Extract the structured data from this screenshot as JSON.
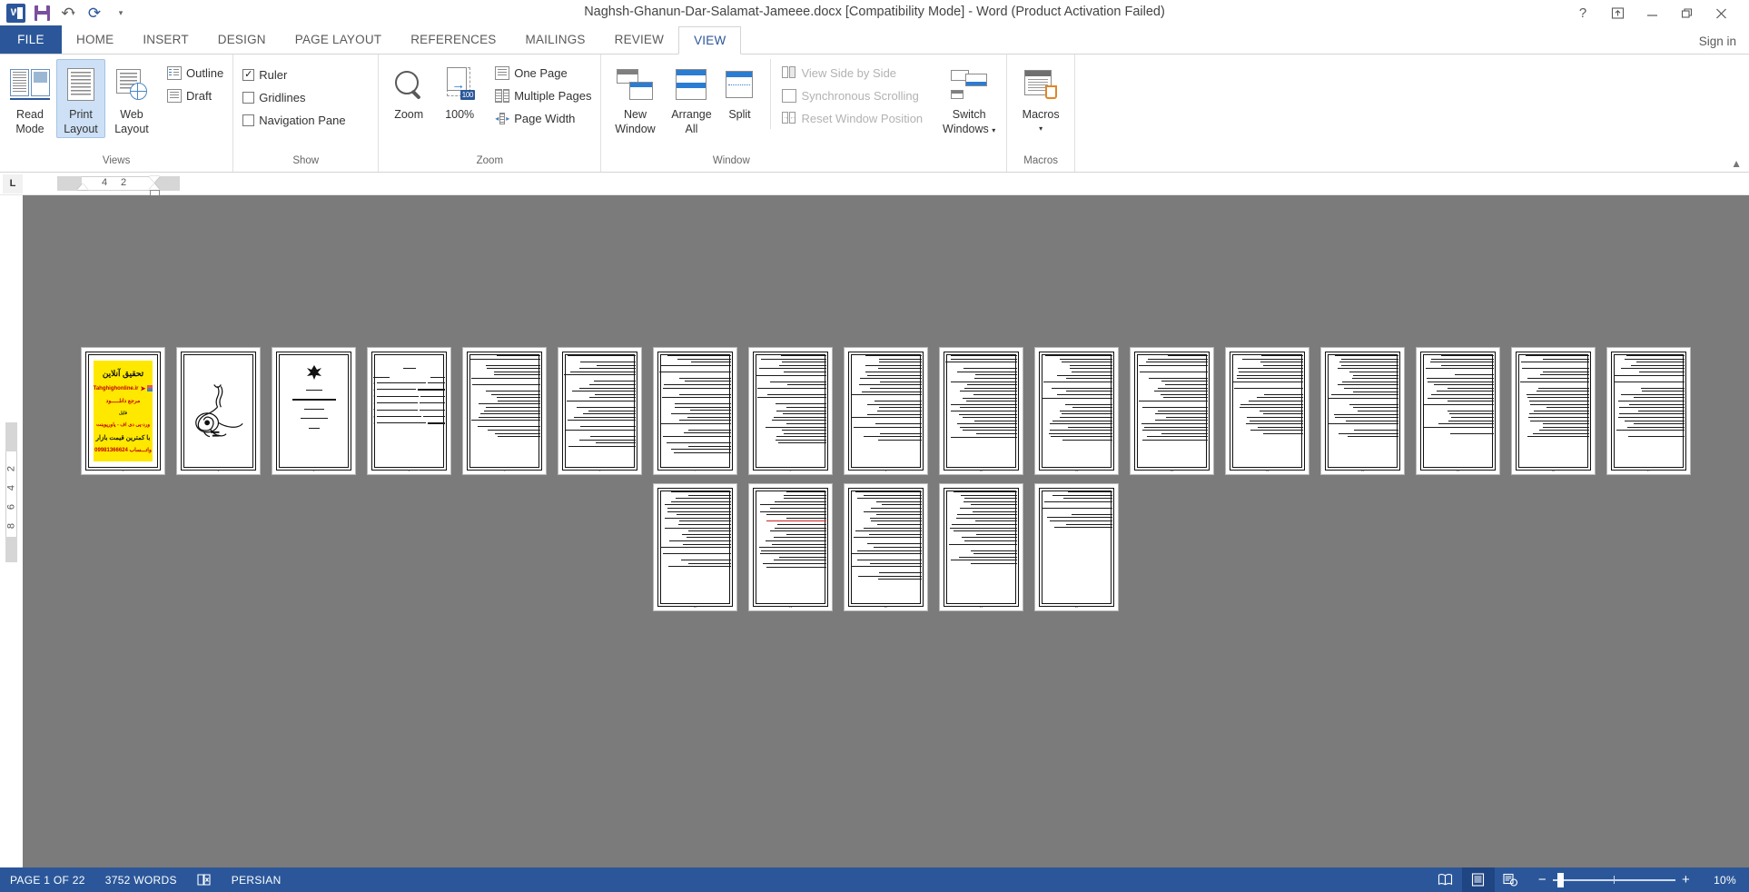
{
  "window": {
    "title": "Naghsh-Ghanun-Dar-Salamat-Jameee.docx [Compatibility Mode] - Word (Product Activation Failed)",
    "help_icon": "?",
    "ribbon_display_icon": "ribbon-display-options-icon",
    "minimize_icon": "minimize-icon",
    "restore_icon": "restore-icon",
    "close_icon": "close-icon"
  },
  "quick_access": {
    "app_logo": "word-logo-icon",
    "save": "save-icon",
    "undo": "undo-icon",
    "redo": "redo-icon",
    "customize": "customize-qat-icon"
  },
  "tabs": {
    "file": "FILE",
    "items": [
      "HOME",
      "INSERT",
      "DESIGN",
      "PAGE LAYOUT",
      "REFERENCES",
      "MAILINGS",
      "REVIEW",
      "VIEW"
    ],
    "active": "VIEW",
    "signin": "Sign in"
  },
  "ribbon": {
    "collapse_icon": "collapse-ribbon-icon",
    "groups": [
      {
        "label": "Views",
        "big_buttons": [
          {
            "label_line1": "Read",
            "label_line2": "Mode",
            "icon": "read-mode-icon",
            "selected": false
          },
          {
            "label_line1": "Print",
            "label_line2": "Layout",
            "icon": "print-layout-icon",
            "selected": true
          },
          {
            "label_line1": "Web",
            "label_line2": "Layout",
            "icon": "web-layout-icon",
            "selected": false
          }
        ],
        "small_items": [
          {
            "label": "Outline",
            "icon": "outline-view-icon"
          },
          {
            "label": "Draft",
            "icon": "draft-view-icon"
          }
        ]
      },
      {
        "label": "Show",
        "checkboxes": [
          {
            "label": "Ruler",
            "checked": true
          },
          {
            "label": "Gridlines",
            "checked": false
          },
          {
            "label": "Navigation Pane",
            "checked": false
          }
        ]
      },
      {
        "label": "Zoom",
        "big_buttons": [
          {
            "label_line1": "Zoom",
            "label_line2": "",
            "icon": "zoom-magnifier-icon",
            "selected": false
          },
          {
            "label_line1": "100%",
            "label_line2": "",
            "icon": "zoom-100-icon",
            "selected": false
          }
        ],
        "small_items": [
          {
            "label": "One Page",
            "icon": "one-page-icon"
          },
          {
            "label": "Multiple Pages",
            "icon": "multiple-pages-icon"
          },
          {
            "label": "Page Width",
            "icon": "page-width-icon"
          }
        ]
      },
      {
        "label": "Window",
        "big_buttons": [
          {
            "label_line1": "New",
            "label_line2": "Window",
            "icon": "new-window-icon",
            "selected": false
          },
          {
            "label_line1": "Arrange",
            "label_line2": "All",
            "icon": "arrange-all-icon",
            "selected": false
          },
          {
            "label_line1": "Split",
            "label_line2": "",
            "icon": "split-window-icon",
            "selected": false
          }
        ],
        "small_items": [
          {
            "label": "View Side by Side",
            "icon": "view-side-by-side-icon",
            "disabled": true
          },
          {
            "label": "Synchronous Scrolling",
            "icon": "synchronous-scrolling-icon",
            "disabled": true
          },
          {
            "label": "Reset Window Position",
            "icon": "reset-window-position-icon",
            "disabled": true
          }
        ],
        "big_buttons_right": [
          {
            "label_line1": "Switch",
            "label_line2": "Windows",
            "icon": "switch-windows-icon",
            "dropdown": true
          }
        ]
      },
      {
        "label": "Macros",
        "big_buttons": [
          {
            "label_line1": "Macros",
            "label_line2": "",
            "icon": "macros-icon",
            "dropdown": true
          }
        ]
      }
    ]
  },
  "rulers": {
    "tab_selector": "L",
    "horizontal_marks": [
      "4",
      "2"
    ],
    "vertical_marks": [
      "2",
      "4",
      "6",
      "8"
    ]
  },
  "document": {
    "page_count": 22,
    "pages": [
      {
        "n": 1,
        "type": "ad"
      },
      {
        "n": 2,
        "type": "calligraphy"
      },
      {
        "n": 3,
        "type": "cover"
      },
      {
        "n": 4,
        "type": "toc"
      },
      {
        "n": 5,
        "type": "text",
        "lines": 22
      },
      {
        "n": 6,
        "type": "text",
        "lines": 24
      },
      {
        "n": 7,
        "type": "text",
        "lines": 25
      },
      {
        "n": 8,
        "type": "text",
        "lines": 25
      },
      {
        "n": 9,
        "type": "text",
        "lines": 24
      },
      {
        "n": 10,
        "type": "text",
        "lines": 25
      },
      {
        "n": 11,
        "type": "text",
        "lines": 25
      },
      {
        "n": 12,
        "type": "text",
        "lines": 24
      },
      {
        "n": 13,
        "type": "text",
        "lines": 23
      },
      {
        "n": 14,
        "type": "text",
        "lines": 24
      },
      {
        "n": 15,
        "type": "text",
        "lines": 22
      },
      {
        "n": 16,
        "type": "text",
        "lines": 24
      },
      {
        "n": 17,
        "type": "text",
        "lines": 23
      },
      {
        "n": 18,
        "type": "text",
        "lines": 22
      },
      {
        "n": 19,
        "type": "text-red",
        "lines": 24
      },
      {
        "n": 20,
        "type": "text",
        "lines": 25
      },
      {
        "n": 21,
        "type": "text",
        "lines": 22
      },
      {
        "n": 22,
        "type": "text-short",
        "lines": 10
      }
    ],
    "ad_page": {
      "line1": "تحقیق آنلاین",
      "line2": "Tahghighonline.ir",
      "line3": "مرجع دانلـــــود",
      "line4": "فایل",
      "line5": "ورد-پی دی اف - پاورپوینت",
      "line6": "با کمترین قیمت بازار",
      "line7": "09981366624 واتـــساب",
      "bg_color": "#ffe800",
      "accent_color": "#c00000"
    },
    "cover_page": {
      "logo": "azad-university-logo-icon"
    }
  },
  "status_bar": {
    "page_indicator": "PAGE 1 OF 22",
    "word_count": "3752 WORDS",
    "proofing_icon": "proofing-errors-icon",
    "language": "PERSIAN",
    "view_buttons": [
      {
        "name": "read-mode-view-button",
        "icon": "read-mode-icon",
        "active": false
      },
      {
        "name": "print-layout-view-button",
        "icon": "print-layout-icon",
        "active": true
      },
      {
        "name": "web-layout-view-button",
        "icon": "web-layout-icon",
        "active": false
      }
    ],
    "zoom_out": "−",
    "zoom_in": "+",
    "zoom_level": "10%"
  },
  "colors": {
    "brand_blue": "#2b579a",
    "tab_active_text": "#2b579a",
    "canvas_grey": "#7b7b7b",
    "selection_blue": "#cde0f5"
  }
}
